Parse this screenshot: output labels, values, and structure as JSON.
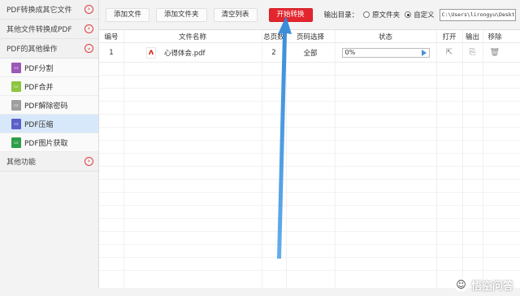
{
  "sidebar": {
    "categories": [
      {
        "label": "PDF转换成其它文件",
        "toggle": "⊙"
      },
      {
        "label": "其他文件转换成PDF",
        "toggle": "⊙"
      },
      {
        "label": "PDF的其他操作",
        "toggle": "⊙"
      }
    ],
    "sub_items": [
      {
        "label": "PDF分割",
        "icon": "pdf-split-icon",
        "color": "#9b59b6"
      },
      {
        "label": "PDF合并",
        "icon": "pdf-merge-icon",
        "color": "#8cc63f"
      },
      {
        "label": "PDF解除密码",
        "icon": "pdf-unlock-icon",
        "color": "#9e9e9e"
      },
      {
        "label": "PDF压缩",
        "icon": "pdf-compress-icon",
        "color": "#5b5fc7"
      },
      {
        "label": "PDF图片获取",
        "icon": "pdf-image-extract-icon",
        "color": "#2e9e48"
      }
    ],
    "other": {
      "label": "其他功能"
    }
  },
  "toolbar": {
    "add_file": "添加文件",
    "add_folder": "添加文件夹",
    "clear_list": "清空列表",
    "start_convert": "开始转换",
    "output_label": "输出目录：",
    "option_source": "原文件夹",
    "option_custom": "自定义",
    "path": "C:\\Users\\lirongyu\\Desktop"
  },
  "table": {
    "headers": {
      "index": "编号",
      "name": "文件名称",
      "pages": "总页数",
      "page_select": "页码选择",
      "status": "状态",
      "open": "打开",
      "output": "输出",
      "remove": "移除"
    },
    "rows": [
      {
        "index": "1",
        "name": "心得体会.pdf",
        "pages": "2",
        "page_select": "全部",
        "progress": "0%"
      }
    ]
  },
  "watermark": {
    "text": "悟空问答"
  },
  "colors": {
    "accent": "#e3262e",
    "arrow": "#3d8fd6",
    "active_bg": "#d8e8fb"
  }
}
